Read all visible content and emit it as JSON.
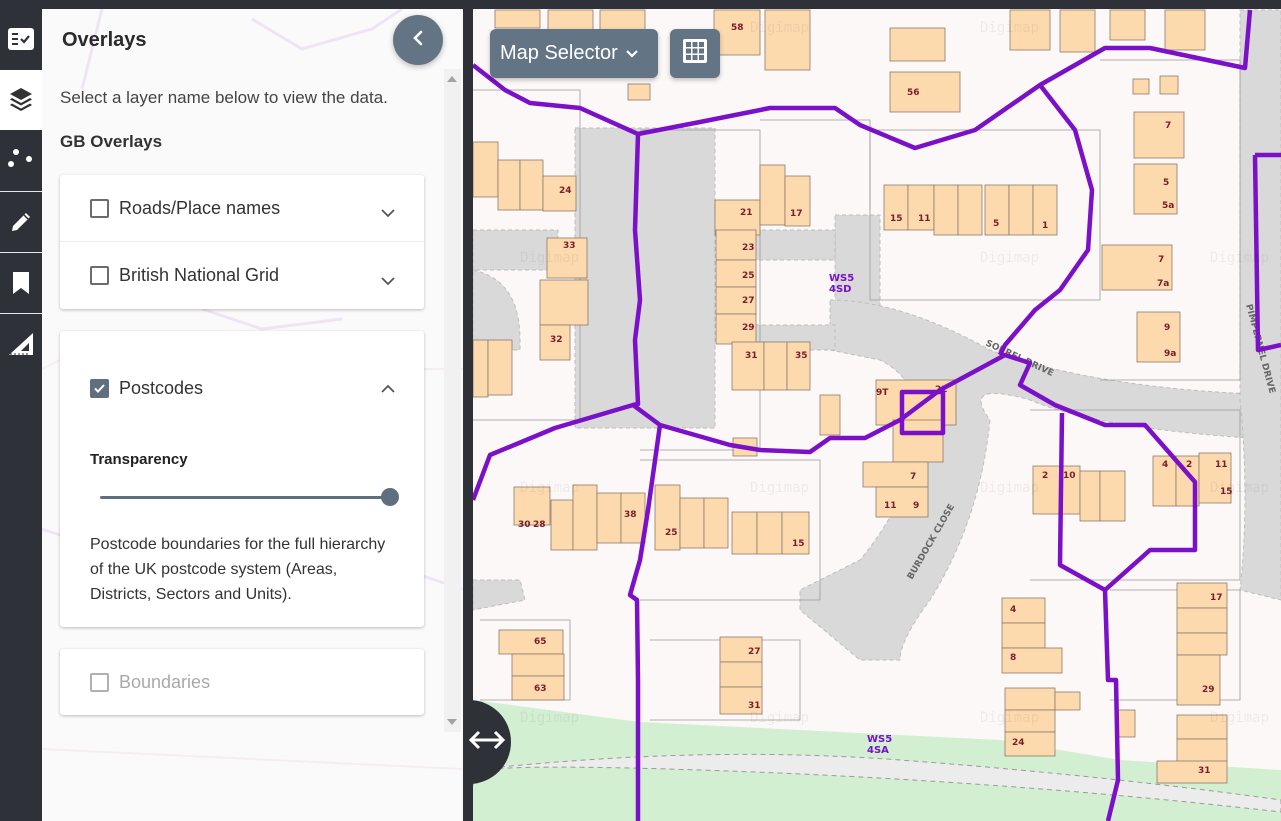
{
  "rail": {
    "items": [
      {
        "name": "checklist",
        "icon": "checklist-icon",
        "active": false
      },
      {
        "name": "layers",
        "icon": "layers-icon",
        "active": true
      },
      {
        "name": "points",
        "icon": "scatter-points-icon",
        "active": false
      },
      {
        "name": "draw",
        "icon": "pencil-icon",
        "active": false
      },
      {
        "name": "bookmarks",
        "icon": "bookmark-icon",
        "active": false
      },
      {
        "name": "measure",
        "icon": "set-square-icon",
        "active": false
      }
    ]
  },
  "panel": {
    "title": "Overlays",
    "collapse_icon": "chevron-left-icon",
    "intro": "Select a layer name below to view the data.",
    "section_title": "GB Overlays",
    "layers": [
      {
        "label": "Roads/Place names",
        "checked": false,
        "expanded": false,
        "disabled": false
      },
      {
        "label": "British National Grid",
        "checked": false,
        "expanded": false,
        "disabled": false
      },
      {
        "label": "Postcodes",
        "checked": true,
        "expanded": true,
        "disabled": false,
        "transparency_label": "Transparency",
        "transparency_value": 1.0,
        "description": "Postcode boundaries for the full hierarchy of the UK postcode system (Areas, Districts, Sectors and Units)."
      },
      {
        "label": "Boundaries",
        "checked": false,
        "expanded": false,
        "disabled": true
      }
    ]
  },
  "map": {
    "selector_label": "Map Selector",
    "grid_icon": "grid-icon",
    "resize_icon": "horizontal-arrows-icon",
    "boundary_color": "#7a10c8",
    "building_color": "#fdd9ae",
    "road_color": "#d9d9d9",
    "green_color": "#d2efd2",
    "postcode_labels": [
      "WS5 4SD",
      "WS5 4SA"
    ],
    "road_labels": [
      "SORREL DRIVE",
      "BURDOCK CLOSE",
      "PIMPERNEL DRIVE"
    ],
    "house_numbers": [
      "58",
      "56",
      "15",
      "11",
      "5",
      "1",
      "7",
      "5",
      "5a",
      "7",
      "7a",
      "9",
      "9a",
      "24",
      "21",
      "17",
      "33",
      "23",
      "25",
      "27",
      "29",
      "32",
      "31",
      "35",
      "9T",
      "22",
      "7",
      "11",
      "9",
      "30",
      "28",
      "38",
      "25",
      "15",
      "10",
      "2",
      "4",
      "2",
      "11",
      "15",
      "17",
      "4",
      "8",
      "65",
      "63",
      "27",
      "31",
      "29",
      "24",
      "31"
    ],
    "watermark": "Digimap"
  }
}
